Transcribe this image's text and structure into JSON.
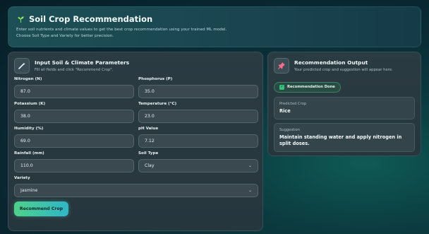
{
  "header": {
    "icon": "sprout-icon",
    "title": "Soil Crop Recommendation",
    "description_line1": "Enter soil nutrients and climate values to get the best crop recommendation using your trained ML model.",
    "description_line2": "Choose Soil Type and Variety for better precision."
  },
  "input_panel": {
    "icon": "wand-icon",
    "title": "Input Soil & Climate Parameters",
    "subtitle": "Fill all fields and click \"Recommend Crop\".",
    "fields": {
      "nitrogen": {
        "label": "Nitrogen (N)",
        "value": "87.0"
      },
      "phosphorus": {
        "label": "Phosphorus (P)",
        "value": "35.0"
      },
      "potassium": {
        "label": "Potassium (K)",
        "value": "38.0"
      },
      "temperature": {
        "label": "Temperature (°C)",
        "value": "23.0"
      },
      "humidity": {
        "label": "Humidity (%)",
        "value": "69.0"
      },
      "ph": {
        "label": "pH Value",
        "value": "7.12"
      },
      "rainfall": {
        "label": "Rainfall (mm)",
        "value": "110.0"
      },
      "soil_type": {
        "label": "Soil Type",
        "value": "Clay"
      },
      "variety": {
        "label": "Variety",
        "value": "Jasmine"
      }
    },
    "button_label": "Recommend Crop"
  },
  "output_panel": {
    "icon": "pin-icon",
    "title": "Recommendation Output",
    "subtitle": "Your predicted crop and suggestion will appear here.",
    "badge": "Recommendation Done",
    "predicted_label": "Predicted Crop",
    "predicted_value": "Rice",
    "suggestion_label": "Suggestion",
    "suggestion_value": "Maintain standing water and apply nitrogen in split doses."
  },
  "colors": {
    "accent_start": "#4fd18a",
    "accent_end": "#2fb6c8",
    "success": "#37c27a"
  }
}
